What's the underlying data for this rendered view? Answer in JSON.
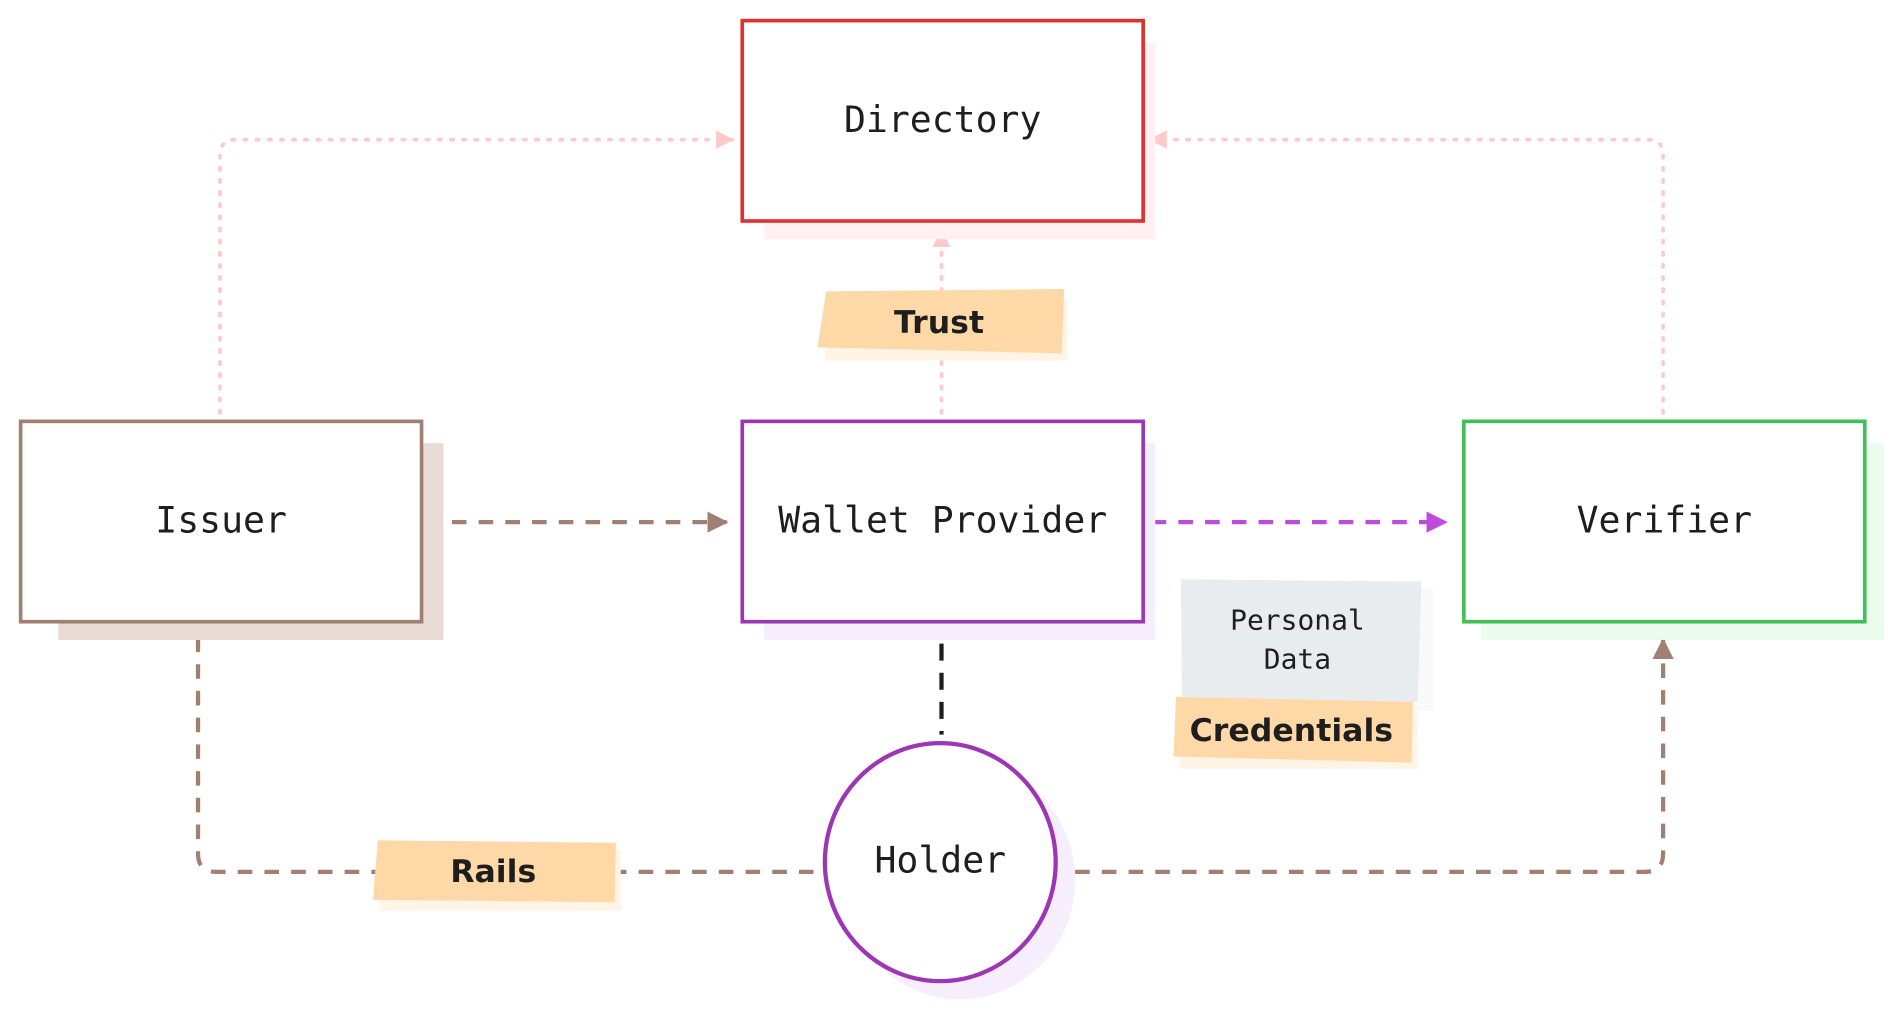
{
  "nodes": {
    "directory": {
      "label": "Directory",
      "stroke": "#e03131",
      "shadow": "#fff0f3"
    },
    "issuer": {
      "label": "Issuer",
      "stroke": "#a18072",
      "shadow": "#e8dbd6"
    },
    "wallet": {
      "label": "Wallet Provider",
      "stroke": "#9c36b5",
      "shadow": "#f6eefc"
    },
    "verifier": {
      "label": "Verifier",
      "stroke": "#40c057",
      "shadow": "#ebfbee"
    },
    "holder": {
      "label": "Holder",
      "stroke": "#9c36b5",
      "shadow": "#f6eefc"
    }
  },
  "labels": {
    "trust": "Trust",
    "rails": "Rails",
    "credentials": "Credentials",
    "personal_data_line1": "Personal",
    "personal_data_line2": "Data"
  },
  "colors": {
    "label_fill": "#ffd8a8",
    "personal_data_fill": "#e9ecef",
    "trust_edge": "#ffc9c9",
    "rails_edge": "#a18072",
    "credential_edge": "#be4bdb",
    "holder_edge": "#1e1e1e"
  }
}
